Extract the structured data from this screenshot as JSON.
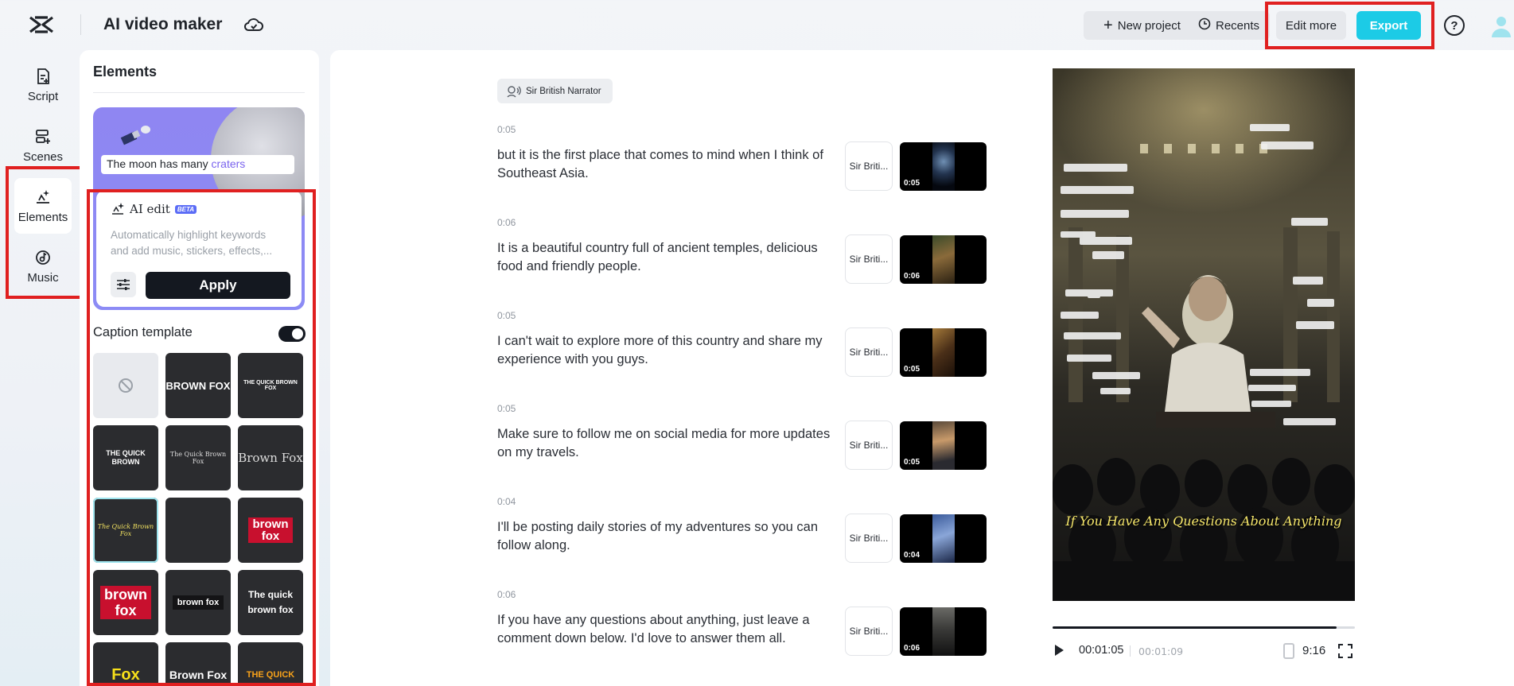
{
  "header": {
    "app_title": "AI video maker",
    "new_project": "New project",
    "recents": "Recents",
    "edit_more": "Edit more",
    "export": "Export",
    "help": "?"
  },
  "rail": {
    "items": [
      {
        "label": "Script",
        "icon": "script-icon"
      },
      {
        "label": "Scenes",
        "icon": "scenes-icon"
      },
      {
        "label": "Elements",
        "icon": "elements-icon",
        "active": true
      },
      {
        "label": "Music",
        "icon": "music-icon"
      }
    ]
  },
  "panel": {
    "title": "Elements",
    "promo_caption_plain": "The moon has many ",
    "promo_caption_highlight": "craters",
    "ai_edit_title": "AI edit",
    "ai_edit_badge": "BETA",
    "ai_edit_desc_line1": "Automatically highlight keywords",
    "ai_edit_desc_line2": "and add music, stickers, effects,...",
    "apply": "Apply",
    "caption_template_title": "Caption template",
    "caption_template_enabled": true,
    "templates": [
      {
        "text": ""
      },
      {
        "text": "BROWN FOX"
      },
      {
        "text": "THE QUICK BROWN FOX"
      },
      {
        "text": "THE QUICK BROWN"
      },
      {
        "text": "The Quick Brown Fox"
      },
      {
        "text": "Brown Fox"
      },
      {
        "text": "The Quick Brown Fox"
      },
      {
        "text": ""
      },
      {
        "text": "brown fox"
      },
      {
        "text": "brown fox"
      },
      {
        "text": "brown fox"
      },
      {
        "text": "The quick brown fox"
      },
      {
        "text": "Fox"
      },
      {
        "text": "Brown Fox"
      },
      {
        "text": "THE QUICK"
      }
    ]
  },
  "script": {
    "narrator": "Sir British Narrator",
    "scenes": [
      {
        "time": "0:05",
        "text": "but it is the first place that comes to mind when I think of Southeast Asia.",
        "voice": "Sir Briti...",
        "duration": "0:05"
      },
      {
        "time": "0:06",
        "text": "It is a beautiful country full of ancient temples, delicious food and friendly people.",
        "voice": "Sir Briti...",
        "duration": "0:06"
      },
      {
        "time": "0:05",
        "text": "I can't wait to explore more of this country and share my experience with you guys.",
        "voice": "Sir Briti...",
        "duration": "0:05"
      },
      {
        "time": "0:05",
        "text": "Make sure to follow me on social media for more updates on my travels.",
        "voice": "Sir Briti...",
        "duration": "0:05"
      },
      {
        "time": "0:04",
        "text": "I'll be posting daily stories of my adventures so you can follow along.",
        "voice": "Sir Briti...",
        "duration": "0:04"
      },
      {
        "time": "0:06",
        "text": "If you have any questions about anything, just leave a comment down below. I'd love to answer them all.",
        "voice": "Sir Briti...",
        "duration": "0:06"
      }
    ]
  },
  "preview": {
    "caption": "If You Have Any Questions About Anything",
    "current_time": "00:01:05",
    "total_time": "00:01:09",
    "progress": 0.94,
    "aspect_ratio": "9:16"
  },
  "colors": {
    "accent": "#1ccbe6",
    "highlight_box": "#e02020",
    "dark_button": "#141820"
  }
}
